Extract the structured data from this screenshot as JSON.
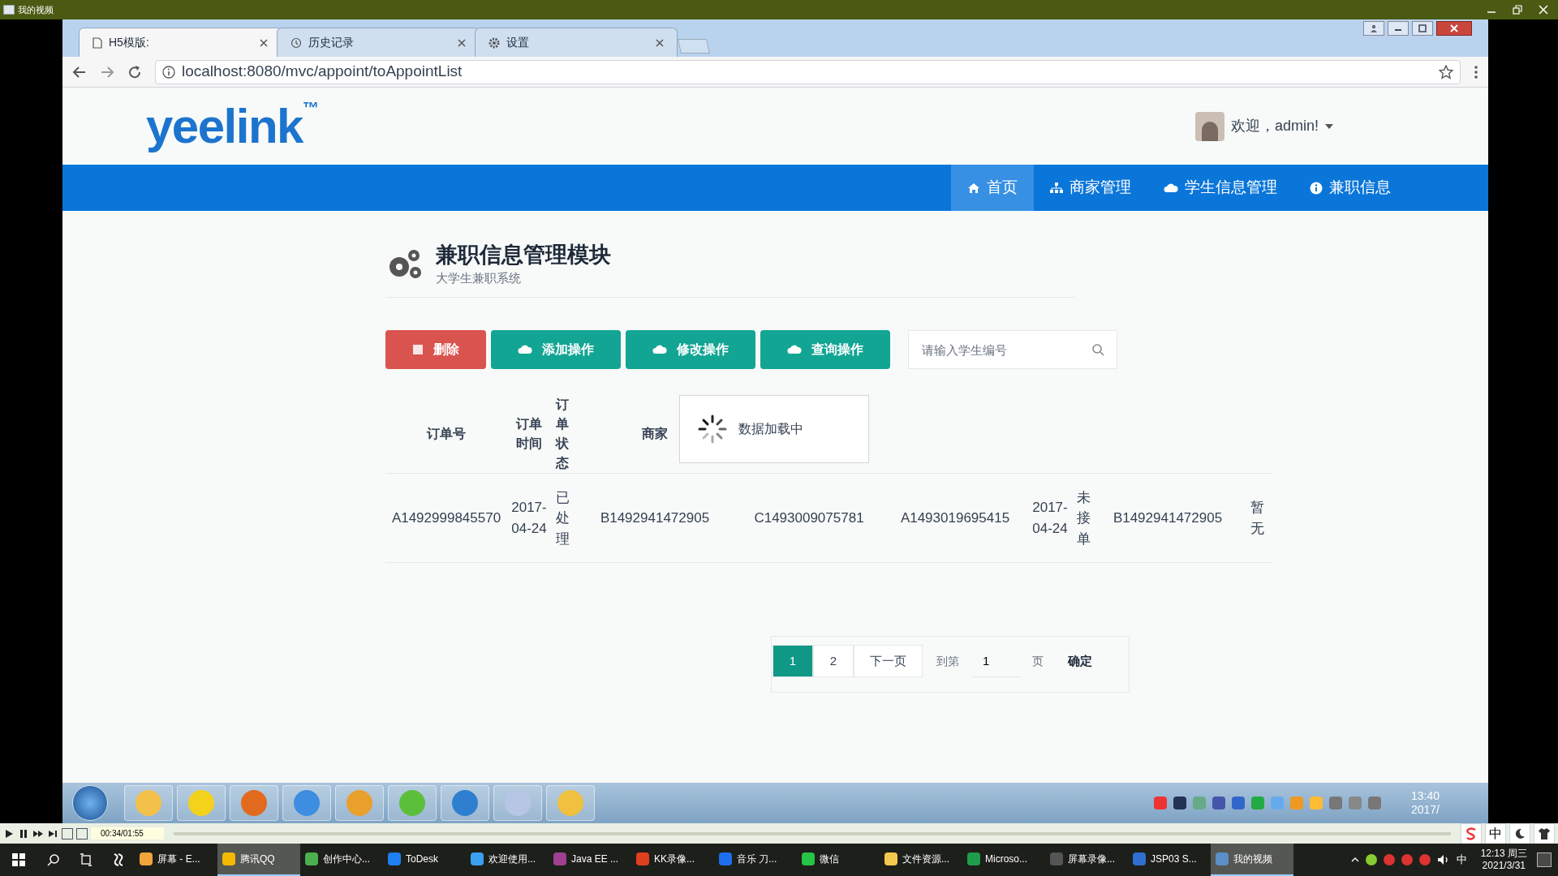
{
  "player_window": {
    "title": "我的视频",
    "time": "00:34/01:55",
    "ime": "中"
  },
  "browser": {
    "tabs": [
      {
        "label": "H5模版:",
        "selected": true,
        "kind": "page"
      },
      {
        "label": "历史记录",
        "selected": false,
        "kind": "history"
      },
      {
        "label": "设置",
        "selected": false,
        "kind": "settings"
      }
    ],
    "url": "localhost:8080/mvc/appoint/toAppointList"
  },
  "site": {
    "logo": "yeelink",
    "trademark": "™",
    "user": "欢迎，admin!",
    "nav": [
      {
        "label": "首页",
        "selected": true,
        "kind": "home"
      },
      {
        "label": "商家管理",
        "selected": false,
        "kind": "sitemap"
      },
      {
        "label": "学生信息管理",
        "selected": false,
        "kind": "cloud"
      },
      {
        "label": "兼职信息",
        "selected": false,
        "kind": "info"
      }
    ]
  },
  "module": {
    "title": "兼职信息管理模块",
    "subtitle": "大学生兼职系统"
  },
  "toolbar": {
    "buttons": [
      {
        "label": "删除",
        "kind": "danger"
      },
      {
        "label": "添加操作",
        "kind": "primary"
      },
      {
        "label": "修改操作",
        "kind": "primary"
      },
      {
        "label": "查询操作",
        "kind": "primary"
      }
    ],
    "search": {
      "placeholder": "请输入学生编号"
    }
  },
  "table": {
    "columns": [
      "订单号",
      "订单时间",
      "订单状态",
      "商家"
    ],
    "rows": [
      [
        "A1492999845570",
        "2017-04-24",
        "已处理",
        "B1492941472905",
        "C1493009075781",
        "A1493019695415",
        "2017-04-24",
        "未接单",
        "B1492941472905",
        "暂无"
      ]
    ]
  },
  "loading": {
    "text": "数据加载中"
  },
  "pagination": {
    "pages": [
      {
        "label": "1",
        "selected": true
      },
      {
        "label": "2",
        "selected": false
      }
    ],
    "next": "下一页",
    "goto": "到第",
    "page_value": "1",
    "page_unit": "页",
    "confirm": "确定"
  },
  "inner_taskbar": {
    "clock": "13:40",
    "date": "2017/"
  },
  "taskbar": {
    "items": [
      "屏幕 - E...",
      "腾讯QQ",
      "创作中心...",
      "ToDesk",
      "欢迎使用...",
      "Java EE ...",
      "KK录像...",
      "音乐 刀...",
      "微信",
      "文件资源...",
      "Microso...",
      "屏幕录像...",
      "JSP03 S...",
      "我的视频"
    ],
    "active": [
      false,
      true,
      false,
      false,
      false,
      false,
      false,
      false,
      false,
      false,
      false,
      false,
      false,
      true
    ],
    "ime": "中",
    "clock": "12:13 周三",
    "date": "2021/3/31"
  }
}
